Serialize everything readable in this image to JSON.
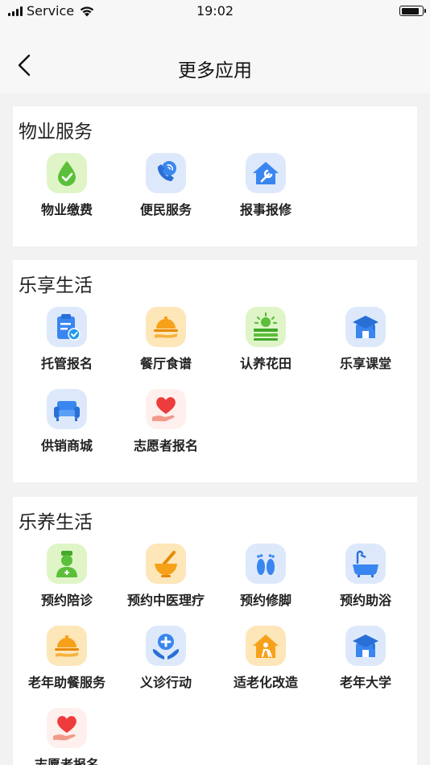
{
  "status_bar": {
    "carrier": "Service",
    "time": "19:02"
  },
  "nav": {
    "title": "更多应用"
  },
  "sections": [
    {
      "title": "物业服务",
      "items": [
        {
          "label": "物业缴费",
          "icon": "water-drop-check-icon"
        },
        {
          "label": "便民服务",
          "icon": "phone-call-icon"
        },
        {
          "label": "报事报修",
          "icon": "house-wrench-icon"
        }
      ]
    },
    {
      "title": "乐享生活",
      "items": [
        {
          "label": "托管报名",
          "icon": "clipboard-check-icon"
        },
        {
          "label": "餐厅食谱",
          "icon": "food-cloche-icon"
        },
        {
          "label": "认养花田",
          "icon": "sun-field-icon"
        },
        {
          "label": "乐享课堂",
          "icon": "graduation-house-icon"
        },
        {
          "label": "供销商城",
          "icon": "sofa-icon"
        },
        {
          "label": "志愿者报名",
          "icon": "heart-hand-icon"
        }
      ]
    },
    {
      "title": "乐养生活",
      "items": [
        {
          "label": "预约陪诊",
          "icon": "nurse-icon"
        },
        {
          "label": "预约中医理疗",
          "icon": "mortar-pestle-icon"
        },
        {
          "label": "预约修脚",
          "icon": "footprints-icon"
        },
        {
          "label": "预约助浴",
          "icon": "bathtub-shower-icon"
        },
        {
          "label": "老年助餐服务",
          "icon": "food-cloche-icon"
        },
        {
          "label": "义诊行动",
          "icon": "medical-cross-hands-icon"
        },
        {
          "label": "适老化改造",
          "icon": "elder-home-icon"
        },
        {
          "label": "老年大学",
          "icon": "graduation-house-icon"
        },
        {
          "label": "志愿者报名",
          "icon": "heart-hand-icon"
        }
      ]
    }
  ]
}
